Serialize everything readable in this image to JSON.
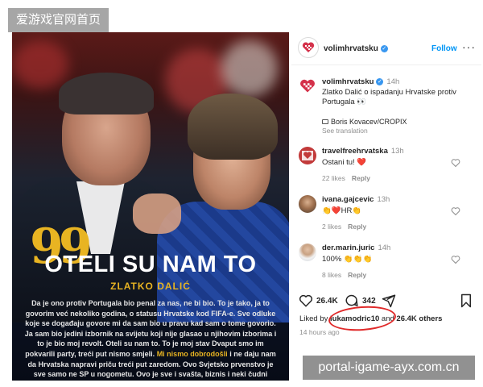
{
  "watermark_top": "爱游戏官网首页",
  "watermark_bottom": "portal-igame-ayx.com.cn",
  "post_image": {
    "quote_glyph": "99",
    "headline": "OTELI SU NAM TO",
    "byline": "ZLATKO DALIĆ",
    "article_before": "Da je ono protiv Portugala bio penal za nas, ne bi bio. To je tako, ja to govorim već nekoliko godina, o statusu Hrvatske kod FIFA-e. Sve odluke koje se događaju govore mi da sam bio u pravu kad sam o tome govorio. Ja sam bio jedini izbornik na svijetu koji nije glasao u njihovim izborima i to je bio moj revolt. Oteli su nam to. To je moj stav Dvaput smo im pokvarili party, treći put nismo smjeli.",
    "article_highlight": "Mi nismo dobrodošli",
    "article_after": "i ne daju nam da Hrvatska napravi priču treći put zaredom. Ovo Svjetsko prvenstvo je sve samo ne SP u nogometu. Ovo je sve i svašta, biznis i neki čudni"
  },
  "header": {
    "username": "volimhrvatsku",
    "follow_label": "Follow",
    "more_label": "···"
  },
  "caption": {
    "username": "volimhrvatsku",
    "time": "14h",
    "text": "Zlatko Dalić o ispadanju Hrvatske protiv Portugala 👀",
    "credit": "Boris Kovacev/CROPIX",
    "see_translation": "See translation"
  },
  "comments": [
    {
      "username": "travelfreehrvatska",
      "time": "13h",
      "text": "Ostani tu! ❤️",
      "likes": "22 likes",
      "reply": "Reply"
    },
    {
      "username": "ivana.gajcevic",
      "time": "13h",
      "text": "👏❤️HR👏",
      "likes": "2 likes",
      "reply": "Reply"
    },
    {
      "username": "der.marin.juric",
      "time": "14h",
      "text": "100% 👏👏👏",
      "likes": "8 likes",
      "reply": "Reply"
    }
  ],
  "actions": {
    "likes_count": "26.4K",
    "comments_count": "342"
  },
  "liked_by": {
    "prefix": "Liked by",
    "user": "lukamodric10",
    "mid": "and",
    "others": "26.4K others"
  },
  "posted_ago": "14 hours ago",
  "colors": {
    "accent_blue": "#0095f6",
    "brand_red": "#d4314a",
    "highlight_yellow": "#e8b422",
    "annotation_red": "#e02a2a"
  },
  "icons": [
    "heart-logo-icon",
    "verified-badge-icon",
    "camera-icon",
    "heart-icon",
    "comment-icon",
    "share-icon",
    "bookmark-icon",
    "more-icon"
  ]
}
